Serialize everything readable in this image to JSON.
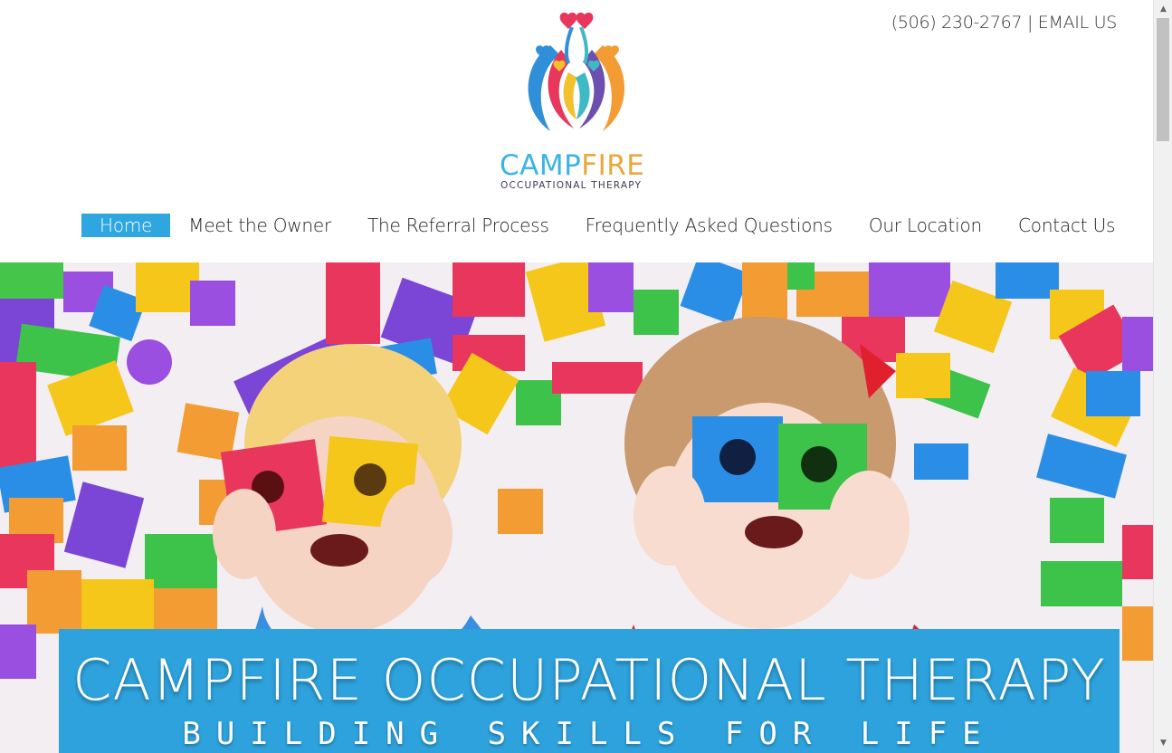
{
  "header": {
    "phone": "(506) 230-2767",
    "separator": "|",
    "email_label": "EMAIL US"
  },
  "logo": {
    "word_part1": "CAMP",
    "word_part2": "FIRE",
    "subtitle": "OCCUPATIONAL THERAPY",
    "colors": [
      "#3ab3e6",
      "#e7a83c",
      "#e8365d",
      "#f39c33",
      "#40b9c6"
    ]
  },
  "nav": {
    "items": [
      {
        "label": "Home",
        "active": true
      },
      {
        "label": "Meet the Owner",
        "active": false
      },
      {
        "label": "The Referral Process",
        "active": false
      },
      {
        "label": "Frequently Asked Questions",
        "active": false
      },
      {
        "label": "Our Location",
        "active": false
      },
      {
        "label": "Contact Us",
        "active": false
      }
    ],
    "active_color": "#2ea6e0"
  },
  "hero": {
    "banner_title": "CAMPFIRE OCCUPATIONAL THERAPY",
    "banner_tagline": "BUILDING SKILLS FOR LIFE",
    "banner_color": "#2ea2dc"
  }
}
